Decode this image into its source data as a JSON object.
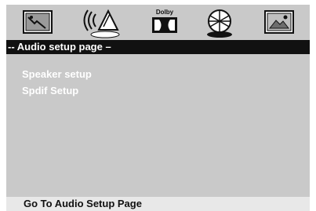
{
  "tabs": [
    {
      "icon": "general-setup-icon"
    },
    {
      "icon": "audio-speaker-icon",
      "selected": true
    },
    {
      "icon": "dolby-icon",
      "label": "Dolby"
    },
    {
      "icon": "video-setup-icon"
    },
    {
      "icon": "preference-icon"
    }
  ],
  "title": "-- Audio setup page –",
  "menu": {
    "items": [
      "Speaker setup",
      "Spdif Setup"
    ]
  },
  "status": "Go To Audio Setup Page",
  "colors": {
    "panel": "#c9c9c9",
    "title_bar": "#111111",
    "status_bar": "#e8e8e8",
    "menu_text": "#ffffff"
  }
}
